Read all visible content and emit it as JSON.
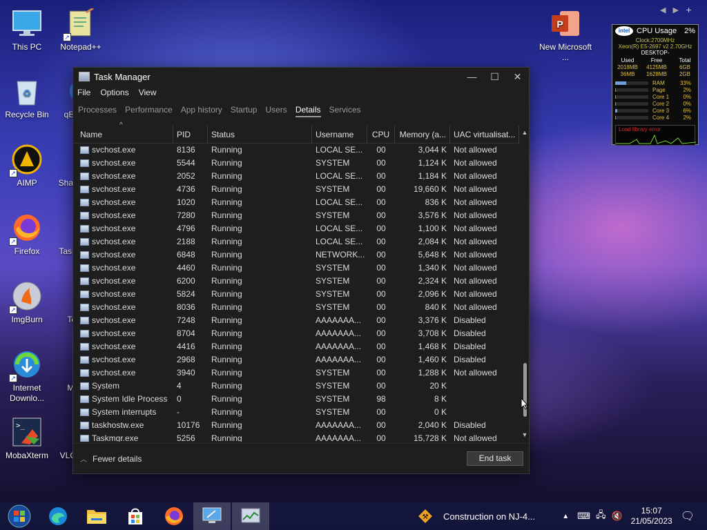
{
  "desktop": {
    "icons": [
      {
        "label": "This PC"
      },
      {
        "label": "Notepad++"
      },
      {
        "label": "Recycle Bin"
      },
      {
        "label": "qBi"
      },
      {
        "label": "AIMP"
      },
      {
        "label": "Shar"
      },
      {
        "label": "Firefox"
      },
      {
        "label": "Task"
      },
      {
        "label": "ImgBurn"
      },
      {
        "label": "Te"
      },
      {
        "label": "Internet Downlo..."
      },
      {
        "label": "Mi"
      },
      {
        "label": "MobaXterm"
      },
      {
        "label": "VLC"
      },
      {
        "label": "New Microsoft ..."
      }
    ]
  },
  "taskmanager": {
    "title": "Task Manager",
    "menu": [
      "File",
      "Options",
      "View"
    ],
    "tabs": [
      "Processes",
      "Performance",
      "App history",
      "Startup",
      "Users",
      "Details",
      "Services"
    ],
    "active_tab": "Details",
    "columns": [
      "Name",
      "PID",
      "Status",
      "Username",
      "CPU",
      "Memory (a...",
      "UAC virtualisat..."
    ],
    "rows": [
      {
        "name": "svchost.exe",
        "pid": "8136",
        "status": "Running",
        "user": "LOCAL SE...",
        "cpu": "00",
        "mem": "3,044 K",
        "uac": "Not allowed"
      },
      {
        "name": "svchost.exe",
        "pid": "5544",
        "status": "Running",
        "user": "SYSTEM",
        "cpu": "00",
        "mem": "1,124 K",
        "uac": "Not allowed"
      },
      {
        "name": "svchost.exe",
        "pid": "2052",
        "status": "Running",
        "user": "LOCAL SE...",
        "cpu": "00",
        "mem": "1,184 K",
        "uac": "Not allowed"
      },
      {
        "name": "svchost.exe",
        "pid": "4736",
        "status": "Running",
        "user": "SYSTEM",
        "cpu": "00",
        "mem": "19,660 K",
        "uac": "Not allowed"
      },
      {
        "name": "svchost.exe",
        "pid": "1020",
        "status": "Running",
        "user": "LOCAL SE...",
        "cpu": "00",
        "mem": "836 K",
        "uac": "Not allowed"
      },
      {
        "name": "svchost.exe",
        "pid": "7280",
        "status": "Running",
        "user": "SYSTEM",
        "cpu": "00",
        "mem": "3,576 K",
        "uac": "Not allowed"
      },
      {
        "name": "svchost.exe",
        "pid": "4796",
        "status": "Running",
        "user": "LOCAL SE...",
        "cpu": "00",
        "mem": "1,100 K",
        "uac": "Not allowed"
      },
      {
        "name": "svchost.exe",
        "pid": "2188",
        "status": "Running",
        "user": "LOCAL SE...",
        "cpu": "00",
        "mem": "2,084 K",
        "uac": "Not allowed"
      },
      {
        "name": "svchost.exe",
        "pid": "6848",
        "status": "Running",
        "user": "NETWORK...",
        "cpu": "00",
        "mem": "5,648 K",
        "uac": "Not allowed"
      },
      {
        "name": "svchost.exe",
        "pid": "4460",
        "status": "Running",
        "user": "SYSTEM",
        "cpu": "00",
        "mem": "1,340 K",
        "uac": "Not allowed"
      },
      {
        "name": "svchost.exe",
        "pid": "6200",
        "status": "Running",
        "user": "SYSTEM",
        "cpu": "00",
        "mem": "2,324 K",
        "uac": "Not allowed"
      },
      {
        "name": "svchost.exe",
        "pid": "5824",
        "status": "Running",
        "user": "SYSTEM",
        "cpu": "00",
        "mem": "2,096 K",
        "uac": "Not allowed"
      },
      {
        "name": "svchost.exe",
        "pid": "8036",
        "status": "Running",
        "user": "SYSTEM",
        "cpu": "00",
        "mem": "840 K",
        "uac": "Not allowed"
      },
      {
        "name": "svchost.exe",
        "pid": "7248",
        "status": "Running",
        "user": "AAAAAAA...",
        "cpu": "00",
        "mem": "3,376 K",
        "uac": "Disabled"
      },
      {
        "name": "svchost.exe",
        "pid": "8704",
        "status": "Running",
        "user": "AAAAAAA...",
        "cpu": "00",
        "mem": "3,708 K",
        "uac": "Disabled"
      },
      {
        "name": "svchost.exe",
        "pid": "4416",
        "status": "Running",
        "user": "AAAAAAA...",
        "cpu": "00",
        "mem": "1,468 K",
        "uac": "Disabled"
      },
      {
        "name": "svchost.exe",
        "pid": "2968",
        "status": "Running",
        "user": "AAAAAAA...",
        "cpu": "00",
        "mem": "1,460 K",
        "uac": "Disabled"
      },
      {
        "name": "svchost.exe",
        "pid": "3940",
        "status": "Running",
        "user": "SYSTEM",
        "cpu": "00",
        "mem": "1,288 K",
        "uac": "Not allowed"
      },
      {
        "name": "System",
        "pid": "4",
        "status": "Running",
        "user": "SYSTEM",
        "cpu": "00",
        "mem": "20 K",
        "uac": ""
      },
      {
        "name": "System Idle Process",
        "pid": "0",
        "status": "Running",
        "user": "SYSTEM",
        "cpu": "98",
        "mem": "8 K",
        "uac": ""
      },
      {
        "name": "System interrupts",
        "pid": "-",
        "status": "Running",
        "user": "SYSTEM",
        "cpu": "00",
        "mem": "0 K",
        "uac": ""
      },
      {
        "name": "taskhostw.exe",
        "pid": "10176",
        "status": "Running",
        "user": "AAAAAAA...",
        "cpu": "00",
        "mem": "2,040 K",
        "uac": "Disabled"
      },
      {
        "name": "Taskmgr.exe",
        "pid": "5256",
        "status": "Running",
        "user": "AAAAAAA...",
        "cpu": "00",
        "mem": "15,728 K",
        "uac": "Not allowed"
      }
    ],
    "fewer_details": "Fewer details",
    "end_task": "End task"
  },
  "gadget": {
    "title": "CPU Usage",
    "percent": "2%",
    "clock": "Clock:2700MHz",
    "cpu_name": "Xeon(R) E5-2697 v2 2.70GHz",
    "host": "DESKTOP-",
    "table_headers": [
      "Used",
      "Free",
      "Total"
    ],
    "table_rows": [
      [
        "2018MB",
        "4125MB",
        "6GB"
      ],
      [
        "36MB",
        "1628MB",
        "2GB"
      ]
    ],
    "bars": [
      {
        "label": "RAM",
        "value": "33%",
        "fill": 0.33
      },
      {
        "label": "Page",
        "value": "2%",
        "fill": 0.02
      },
      {
        "label": "Core 1",
        "value": "0%",
        "fill": 0.0
      },
      {
        "label": "Core 2",
        "value": "0%",
        "fill": 0.0
      },
      {
        "label": "Core 3",
        "value": "6%",
        "fill": 0.06
      },
      {
        "label": "Core 4",
        "value": "2%",
        "fill": 0.02
      }
    ],
    "error": "Load library error"
  },
  "taskbar": {
    "notification": "Construction on NJ-4...",
    "time": "15:07",
    "date": "21/05/2023"
  },
  "colors": {
    "accent": "#9a9a9a",
    "window_bg": "#1e1e1e"
  }
}
